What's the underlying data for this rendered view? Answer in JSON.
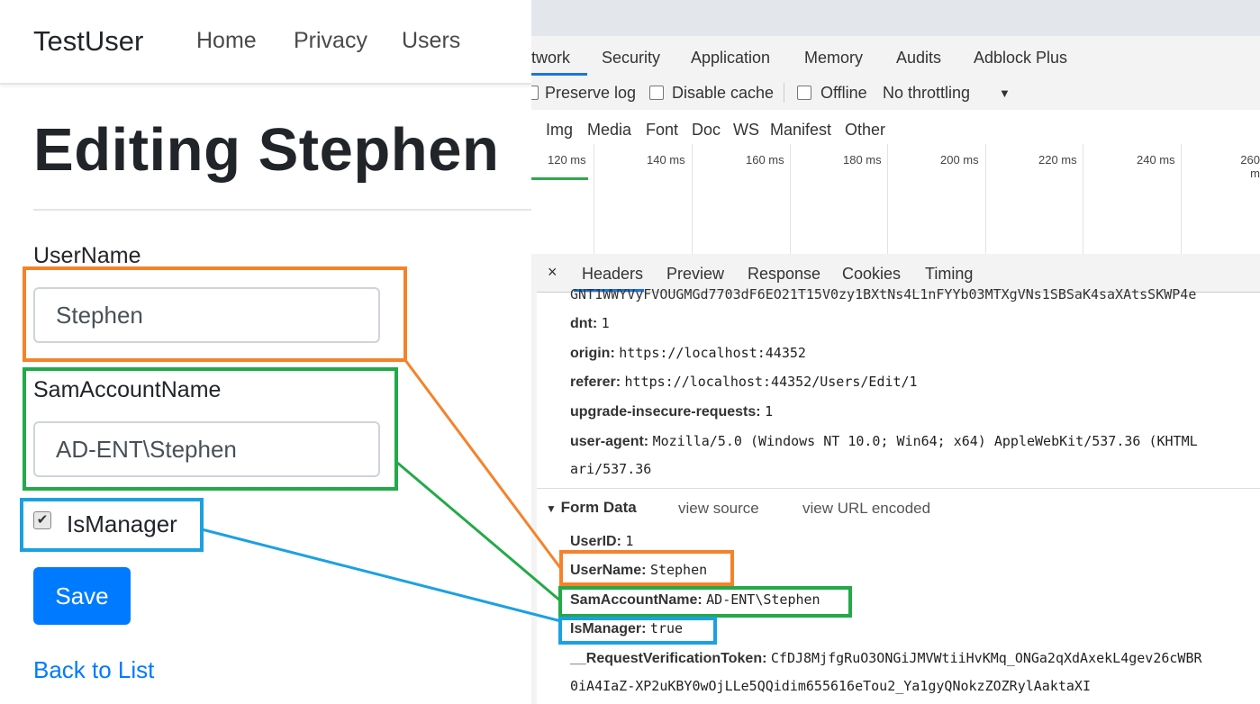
{
  "app": {
    "brand": "TestUser",
    "nav": [
      "Home",
      "Privacy",
      "Users"
    ],
    "page_title": "Editing Stephen",
    "form": {
      "username_label": "UserName",
      "username_value": "Stephen",
      "sam_label": "SamAccountName",
      "sam_value": "AD-ENT\\Stephen",
      "ismanager_label": "IsManager",
      "ismanager_checked": true,
      "save_label": "Save",
      "back_label": "Back to List"
    }
  },
  "devtools": {
    "panel_tabs": [
      "twork",
      "Security",
      "Application",
      "Memory",
      "Audits",
      "Adblock Plus"
    ],
    "toolbar": {
      "preserve_log": "Preserve log",
      "disable_cache": "Disable cache",
      "offline": "Offline",
      "throttling": "No throttling"
    },
    "filters": [
      "Img",
      "Media",
      "Font",
      "Doc",
      "WS",
      "Manifest",
      "Other"
    ],
    "timeline_ticks": [
      "120 ms",
      "140 ms",
      "160 ms",
      "180 ms",
      "200 ms",
      "220 ms",
      "240 ms",
      "260 m"
    ],
    "detail_tabs": [
      "Headers",
      "Preview",
      "Response",
      "Cookies",
      "Timing"
    ],
    "close_glyph": "×",
    "request_headers": {
      "cut_off": "GNT1WWYVyFVOUGMGd7703dF6EO21T15V0zy1BXtNs4L1nFYYb03MTXgVNs1SBSaK4saXAtsSKWP4e",
      "dnt_key": "dnt:",
      "dnt_val": "1",
      "origin_key": "origin:",
      "origin_val": "https://localhost:44352",
      "referer_key": "referer:",
      "referer_val": "https://localhost:44352/Users/Edit/1",
      "uir_key": "upgrade-insecure-requests:",
      "uir_val": "1",
      "ua_key": "user-agent:",
      "ua_val": "Mozilla/5.0 (Windows NT 10.0; Win64; x64) AppleWebKit/537.36 (KHTML",
      "ua_cont": "ari/537.36"
    },
    "form_data": {
      "heading": "Form Data",
      "view_source": "view source",
      "view_url": "view URL encoded",
      "userid_key": "UserID:",
      "userid_val": "1",
      "username_key": "UserName:",
      "username_val": "Stephen",
      "sam_key": "SamAccountName:",
      "sam_val": "AD-ENT\\Stephen",
      "ismanager_key": "IsManager:",
      "ismanager_val": "true",
      "token_key": "__RequestVerificationToken:",
      "token_val": "CfDJ8MjfgRuO3ONGiJMVWtiiHvKMq_ONGa2qXdAxekL4gev26cWBR",
      "token_cont": "0iA4IaZ-XP2uKBY0wOjLLe5QQidim655616eTou2_Ya1gyQNokzZOZRylAaktaXI"
    }
  },
  "colors": {
    "orange": "#f5822a",
    "green": "#22aa48",
    "blue": "#1ba1e2",
    "primary": "#007bff"
  }
}
